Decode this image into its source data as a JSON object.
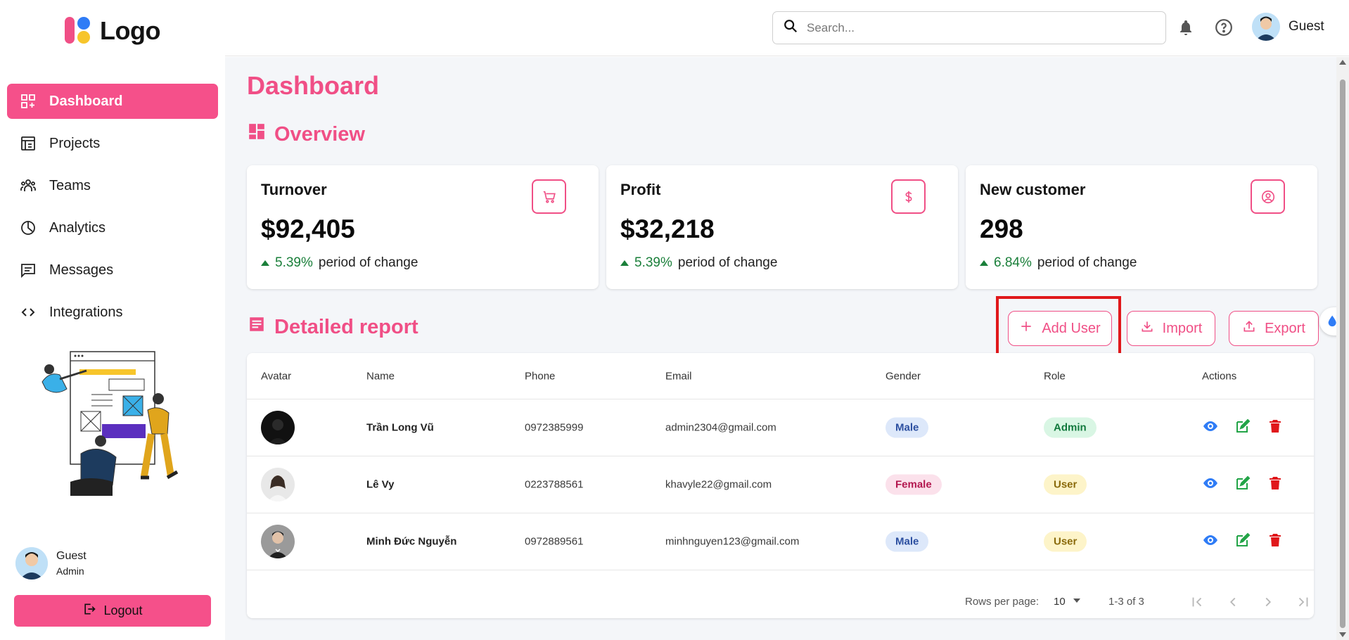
{
  "brand": {
    "logo_text": "Logo"
  },
  "sidebar": {
    "items": [
      {
        "label": "Dashboard",
        "icon": "dashboard-icon",
        "active": true
      },
      {
        "label": "Projects",
        "icon": "projects-icon"
      },
      {
        "label": "Teams",
        "icon": "teams-icon"
      },
      {
        "label": "Analytics",
        "icon": "analytics-icon"
      },
      {
        "label": "Messages",
        "icon": "messages-icon"
      },
      {
        "label": "Integrations",
        "icon": "code-icon"
      }
    ],
    "user": {
      "name": "Guest",
      "role": "Admin"
    },
    "logout_label": "Logout"
  },
  "topbar": {
    "search_placeholder": "Search...",
    "user_name": "Guest"
  },
  "page": {
    "title": "Dashboard",
    "overview_title": "Overview",
    "report_title": "Detailed report"
  },
  "cards": [
    {
      "title": "Turnover",
      "value": "$92,405",
      "change": "5.39%",
      "change_text": "period of change",
      "icon": "cart-icon"
    },
    {
      "title": "Profit",
      "value": "$32,218",
      "change": "5.39%",
      "change_text": "period of change",
      "icon": "dollar-icon"
    },
    {
      "title": "New customer",
      "value": "298",
      "change": "6.84%",
      "change_text": "period of change",
      "icon": "user-circle-icon"
    }
  ],
  "report_buttons": {
    "add_user": "Add User",
    "import": "Import",
    "export": "Export"
  },
  "table": {
    "headers": [
      "Avatar",
      "Name",
      "Phone",
      "Email",
      "Gender",
      "Role",
      "Actions"
    ],
    "rows": [
      {
        "name": "Trần Long Vũ",
        "phone": "0972385999",
        "email": "admin2304@gmail.com",
        "gender": "Male",
        "role": "Admin"
      },
      {
        "name": "Lê Vy",
        "phone": "0223788561",
        "email": "khavyle22@gmail.com",
        "gender": "Female",
        "role": "User"
      },
      {
        "name": "Minh Đức Nguyễn",
        "phone": "0972889561",
        "email": "minhnguyen123@gmail.com",
        "gender": "Male",
        "role": "User"
      }
    ],
    "pagination": {
      "rows_per_page_label": "Rows per page:",
      "rows_per_page": "10",
      "range": "1-3 of 3"
    }
  },
  "colors": {
    "accent": "#f04f86",
    "accent_bg": "#f5508a",
    "positive": "#1a7f3a",
    "view_icon": "#2f7cf6",
    "edit_icon": "#22a447",
    "delete_icon": "#e0181b"
  }
}
